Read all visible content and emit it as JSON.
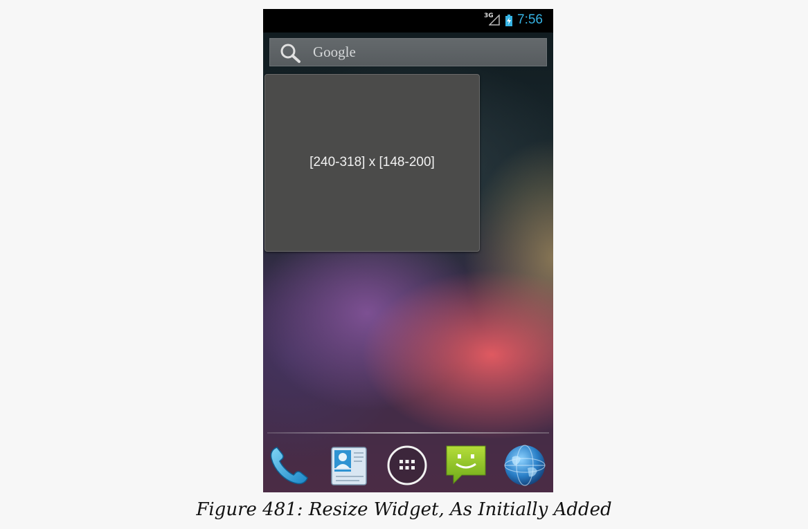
{
  "status_bar": {
    "network_type": "3G",
    "time": "7:56",
    "icons": [
      "signal-icon",
      "battery-charging-icon"
    ],
    "colors": {
      "clock": "#36b3e4",
      "battery": "#36b3e4"
    }
  },
  "search": {
    "label": "Google",
    "icon": "search-icon"
  },
  "widget": {
    "text": "[240-318] x [148-200]"
  },
  "dock": {
    "items": [
      {
        "name": "phone",
        "icon": "phone-icon"
      },
      {
        "name": "people",
        "icon": "contacts-icon"
      },
      {
        "name": "all-apps",
        "icon": "app-drawer-icon"
      },
      {
        "name": "messaging",
        "icon": "messaging-icon"
      },
      {
        "name": "browser",
        "icon": "globe-icon"
      }
    ]
  },
  "caption": "Figure 481: Resize Widget, As Initially Added"
}
